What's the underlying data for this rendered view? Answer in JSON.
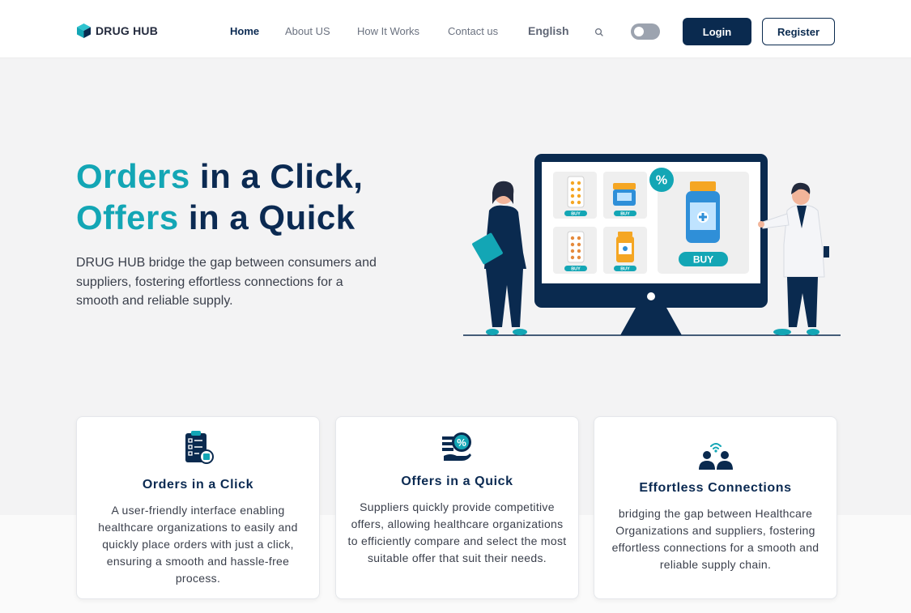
{
  "brand": {
    "name": "DRUG HUB",
    "logo_icon": "cube-icon",
    "logo_color": "#13a6b5"
  },
  "nav": {
    "links": [
      "Home",
      "About US",
      "How It Works",
      "Contact us"
    ],
    "active": "Home",
    "language": "English",
    "search_icon": "search-icon",
    "theme_toggle_on": false,
    "login_label": "Login",
    "register_label": "Register"
  },
  "hero": {
    "title_line1_accent": "Orders",
    "title_line1_rest": " in a Click,",
    "title_line2_accent": "Offers",
    "title_line2_rest": " in a Quick",
    "description": "DRUG HUB bridge the gap between consumers and suppliers, fostering effortless connections for a smooth and reliable supply.",
    "illustration": {
      "name": "pharmacy-marketplace-illustration",
      "buy_small": "BUY",
      "buy_large": "BUY",
      "discount_badge": "%"
    }
  },
  "cards": [
    {
      "icon": "clipboard-checklist-icon",
      "title": "Orders in a Click",
      "text": "A user-friendly interface enabling healthcare organizations to easily and quickly place orders with just a click, ensuring a smooth and hassle-free process."
    },
    {
      "icon": "discount-offer-icon",
      "title": "Offers in a Quick",
      "text": "Suppliers quickly provide competitive offers, allowing healthcare organizations to efficiently compare and select the most suitable offer that suit their needs."
    },
    {
      "icon": "connected-people-icon",
      "title": "Effortless Connections",
      "text": "bridging the gap between Healthcare Organizations and suppliers, fostering effortless connections for a smooth and reliable supply chain."
    }
  ],
  "colors": {
    "primary": "#0a2a4f",
    "accent": "#13a6b5",
    "background": "#f3f3f4",
    "orange": "#f5a623"
  }
}
